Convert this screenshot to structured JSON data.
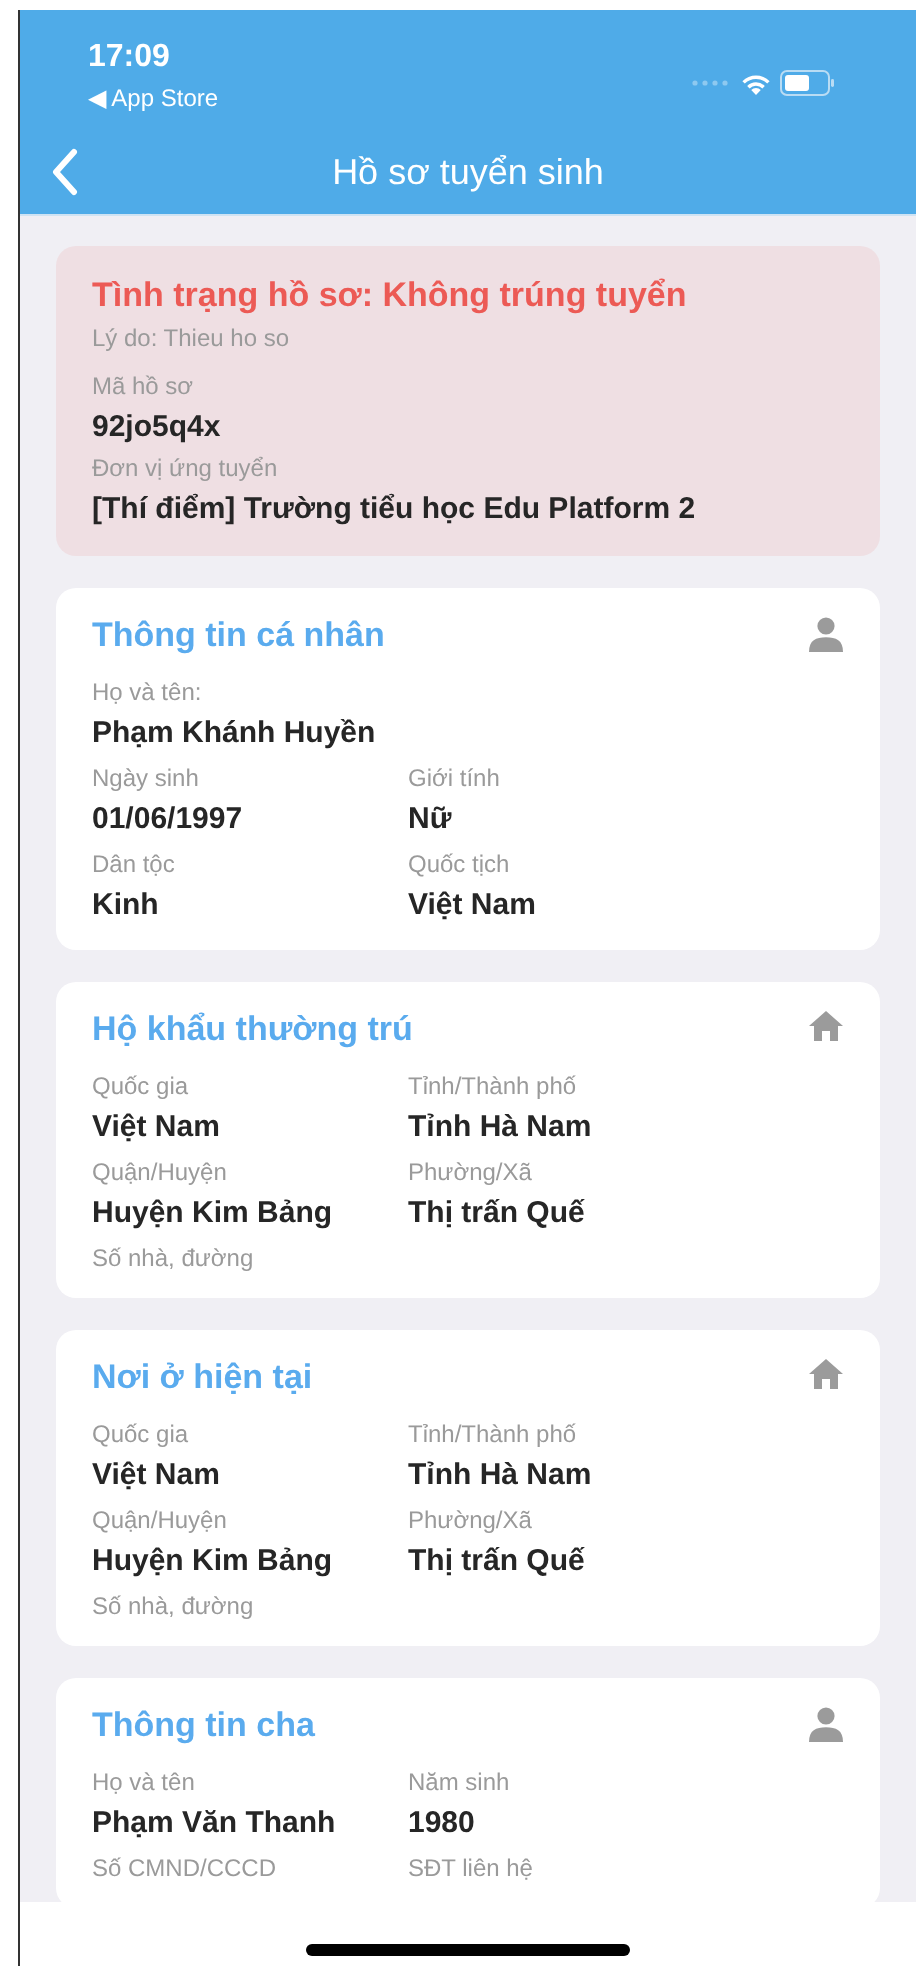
{
  "status_bar": {
    "time": "17:09",
    "back_link": "◀ App Store"
  },
  "nav": {
    "title": "Hồ sơ tuyển sinh"
  },
  "status_card": {
    "status": "Tình trạng hồ sơ: Không trúng tuyển",
    "reason": "Lý do: Thieu ho so",
    "fields": [
      {
        "label": "Mã hồ sơ",
        "value": "92jo5q4x"
      },
      {
        "label": "Đơn vị ứng tuyển",
        "value": "[Thí điểm] Trường tiểu học Edu Platform 2"
      }
    ]
  },
  "sections": [
    {
      "title": "Thông tin cá nhân",
      "kind": "person",
      "rows": [
        [
          {
            "label": "Họ và tên:",
            "value": "Phạm Khánh Huyền"
          }
        ],
        [
          {
            "label": "Ngày sinh",
            "value": "01/06/1997"
          },
          {
            "label": "Giới tính",
            "value": "Nữ"
          }
        ],
        [
          {
            "label": "Dân tộc",
            "value": "Kinh"
          },
          {
            "label": "Quốc tịch",
            "value": "Việt Nam"
          }
        ]
      ]
    },
    {
      "title": "Hộ khẩu thường trú",
      "kind": "home",
      "rows": [
        [
          {
            "label": "Quốc gia",
            "value": "Việt Nam"
          },
          {
            "label": "Tỉnh/Thành phố",
            "value": "Tỉnh Hà Nam"
          }
        ],
        [
          {
            "label": "Quận/Huyện",
            "value": "Huyện Kim Bảng"
          },
          {
            "label": "Phường/Xã",
            "value": "Thị trấn Quế"
          }
        ],
        [
          {
            "label": "Số nhà, đường"
          }
        ]
      ]
    },
    {
      "title": "Nơi ở hiện tại",
      "kind": "home",
      "rows": [
        [
          {
            "label": "Quốc gia",
            "value": "Việt Nam"
          },
          {
            "label": "Tỉnh/Thành phố",
            "value": "Tỉnh Hà Nam"
          }
        ],
        [
          {
            "label": "Quận/Huyện",
            "value": "Huyện Kim Bảng"
          },
          {
            "label": "Phường/Xã",
            "value": "Thị trấn Quế"
          }
        ],
        [
          {
            "label": "Số nhà, đường"
          }
        ]
      ]
    },
    {
      "title": "Thông tin cha",
      "kind": "person",
      "rows": [
        [
          {
            "label": "Họ và tên",
            "value": "Phạm Văn Thanh"
          },
          {
            "label": "Năm sinh",
            "value": "1980"
          }
        ],
        [
          {
            "label": "Số CMND/CCCD"
          },
          {
            "label": "SĐT liên hệ"
          }
        ]
      ]
    }
  ]
}
